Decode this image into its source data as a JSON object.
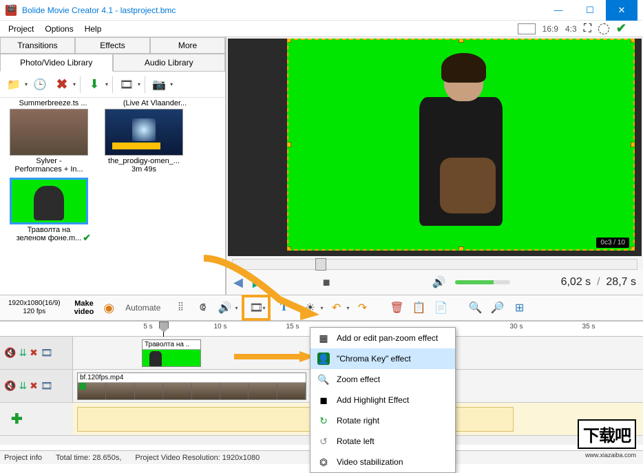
{
  "title": "Bolide Movie Creator 4.1 - lastproject.bmc",
  "menu": {
    "project": "Project",
    "options": "Options",
    "help": "Help"
  },
  "aspect": {
    "r169": "16:9",
    "r43": "4:3"
  },
  "tabs1": {
    "transitions": "Transitions",
    "effects": "Effects",
    "more": "More"
  },
  "tabs2": {
    "photo": "Photo/Video Library",
    "audio": "Audio Library"
  },
  "library": {
    "partial1": "Summerbreeze.ts ...",
    "partial2": "(Live At Vlaander...",
    "item1_line1": "Sylver -",
    "item1_line2": "Performances + In...",
    "item2_line1": "the_prodigy-omen_...",
    "item2_line2": "3m 49s",
    "item3_line1": "Траволта на",
    "item3_line2": "зеленом фоне.m..."
  },
  "preview": {
    "timecounter": "0c3 / 10"
  },
  "playback": {
    "current": "6,02 s",
    "total": "28,7 s"
  },
  "info": {
    "resolution": "1920x1080(16/9)",
    "fps": "120 fps"
  },
  "makevideo": "Make\nvideo",
  "automate": "Automate",
  "timeline": {
    "t5": "5 s",
    "t10": "10 s",
    "t15": "15 s",
    "t30": "30 s",
    "t35": "35 s",
    "clip1_label": "Траволта на ..",
    "clip2_label": "bf.120fps.mp4"
  },
  "contextmenu": {
    "panzoom": "Add or edit pan-zoom effect",
    "chroma": "\"Chroma Key\" effect",
    "zoom": "Zoom effect",
    "highlight": "Add Highlight Effect",
    "rotr": "Rotate right",
    "rotl": "Rotate left",
    "stab": "Video stabilization"
  },
  "status": {
    "project_info": "Project info",
    "total": "Total time:  28.650s,",
    "res": "Project Video Resolution:   1920x1080"
  },
  "watermark": "下载吧",
  "watermark_sub": "www.xiazaiba.com"
}
